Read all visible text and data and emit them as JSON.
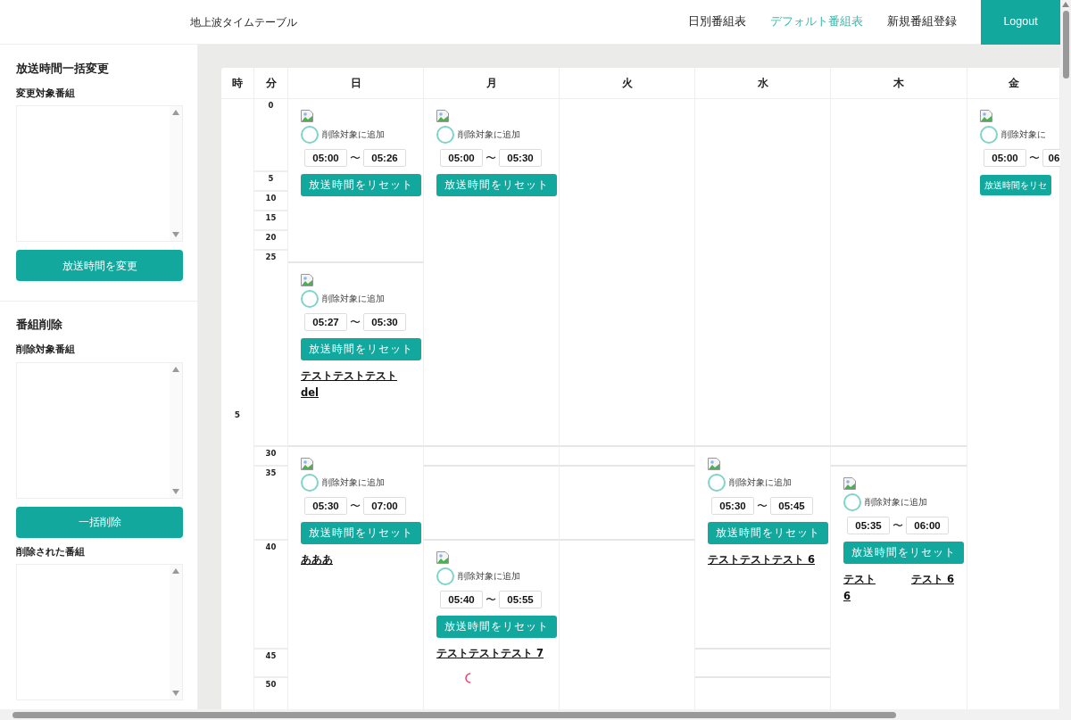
{
  "header": {
    "title": "地上波タイムテーブル",
    "nav": [
      {
        "label": "日別番組表",
        "selected": false
      },
      {
        "label": "デフォルト番組表",
        "selected": true
      },
      {
        "label": "新規番組登録",
        "selected": false
      }
    ],
    "logout": "Logout"
  },
  "sidebar": {
    "sections": [
      {
        "title": "放送時間一括変更",
        "items": [
          {
            "kind": "list",
            "label": "変更対象番組"
          },
          {
            "kind": "button",
            "label": "放送時間を変更"
          }
        ]
      },
      {
        "title": "番組削除",
        "items": [
          {
            "kind": "list",
            "label": "削除対象番組"
          },
          {
            "kind": "button",
            "label": "一括削除"
          },
          {
            "kind": "list",
            "label": "削除された番組"
          }
        ]
      }
    ]
  },
  "timetable": {
    "hour_heading": "時",
    "minute_heading": "分",
    "hour": "5",
    "minutes": [
      "0",
      "5",
      "10",
      "15",
      "20",
      "25",
      "30",
      "35",
      "40",
      "45",
      "50"
    ],
    "columns": [
      {
        "day": "日",
        "programs": [
          {
            "checked": false,
            "check_label": "削除対象に追加",
            "start": "05:00",
            "separator": "〜",
            "end": "05:26",
            "button": "放送時間をリセット"
          },
          {
            "checked": false,
            "check_label": "削除対象に追加",
            "start": "05:27",
            "separator": "〜",
            "end": "05:30",
            "button": "放送時間をリセット",
            "titles": [
              "テストテストテスト del"
            ]
          },
          {
            "checked": false,
            "check_label": "削除対象に追加",
            "start": "05:30",
            "separator": "〜",
            "end": "07:00",
            "button": "放送時間をリセット",
            "titles": [
              "あああ"
            ]
          }
        ]
      },
      {
        "day": "月",
        "programs": [
          {
            "checked": false,
            "check_label": "削除対象に追加",
            "start": "05:00",
            "separator": "〜",
            "end": "05:30",
            "button": "放送時間をリセット"
          },
          {
            "checked": false,
            "check_label": "削除対象に追加",
            "start": "05:40",
            "separator": "〜",
            "end": "05:55",
            "button": "放送時間をリセット",
            "titles": [
              "テストテストテスト 7"
            ]
          }
        ]
      },
      {
        "day": "火"
      },
      {
        "day": "水",
        "programs": [
          {
            "checked": false,
            "check_label": "削除対象に追加",
            "start": "05:30",
            "separator": "〜",
            "end": "05:45",
            "button": "放送時間をリセット",
            "titles": [
              "テストテストテスト 6"
            ]
          }
        ]
      },
      {
        "day": "木",
        "programs": [
          {
            "checked": false,
            "check_label": "削除対象に追加",
            "start": "05:35",
            "separator": "〜",
            "end": "06:00",
            "button": "放送時間をリセット",
            "titles": [
              "テスト 6",
              "テスト 6"
            ]
          }
        ]
      },
      {
        "day": "金",
        "programs": [
          {
            "checked": false,
            "check_label": "削除対象に",
            "start": "05:00",
            "separator": "〜",
            "end": "06",
            "button": "放送時間をリセ"
          }
        ]
      }
    ]
  }
}
